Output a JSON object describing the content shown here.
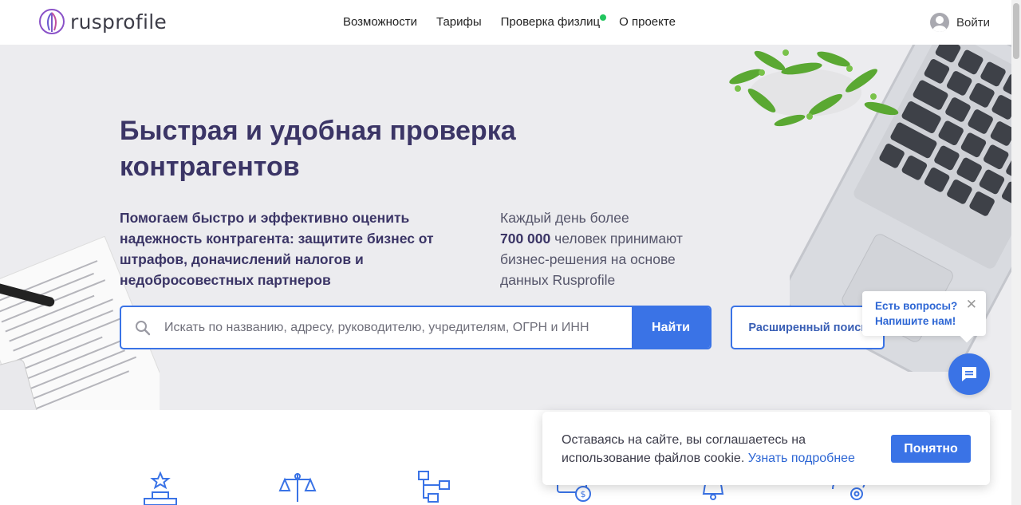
{
  "header": {
    "logo_text": "rusprofile",
    "nav": [
      "Возможности",
      "Тарифы",
      "Проверка физлиц",
      "О проекте"
    ],
    "login_label": "Войти"
  },
  "hero": {
    "title": "Быстрая и удобная проверка контрагентов",
    "subtitle": "Помогаем быстро и эффективно оценить надежность контрагента: защитите бизнес от штрафов, доначислений налогов и недобросовестных партнеров",
    "stats_prefix": "Каждый день более",
    "stats_number": "700 000",
    "stats_suffix": "человек принимают бизнес-решения на основе данных Rusprofile"
  },
  "search": {
    "placeholder": "Искать по названию, адресу, руководителю, учредителям, ОГРН и ИНН",
    "button_label": "Найти",
    "advanced_label": "Расширенный поиск"
  },
  "chat": {
    "line1": "Есть вопросы?",
    "line2": "Напишите нам!",
    "close_symbol": "✕"
  },
  "cookie": {
    "text": "Оставаясь на сайте, вы соглашаетесь на использование файлов cookie.",
    "link": "Узнать подробнее",
    "button_label": "Понятно"
  },
  "colors": {
    "accent": "#3a73e6",
    "title": "#3b3566",
    "hero_bg": "#ececef",
    "online_dot": "#22c55e"
  },
  "feature_icons": [
    "award-icon",
    "scales-icon",
    "network-icon",
    "money-icon",
    "bell-icon",
    "gear-icon"
  ]
}
